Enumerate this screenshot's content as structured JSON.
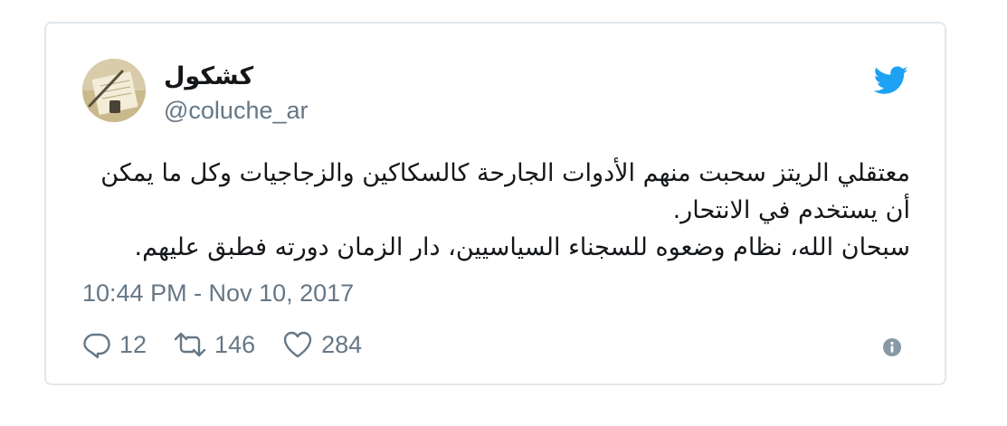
{
  "user": {
    "display_name": "كشكول",
    "handle": "@coluche_ar"
  },
  "tweet": {
    "lines": [
      "معتقلي الريتز سحبت منهم الأدوات الجارحة كالسكاكين والزجاجيات وكل ما يمكن",
      "أن يستخدم في الانتحار.",
      "سبحان الله، نظام وضعوه للسجناء السياسيين، دار الزمان دورته فطبق عليهم."
    ],
    "timestamp": "10:44 PM - Nov 10, 2017"
  },
  "actions": {
    "replies": "12",
    "retweets": "146",
    "likes": "284"
  },
  "icons": {
    "brand": "twitter-bird-icon",
    "reply": "reply-icon",
    "retweet": "retweet-icon",
    "like": "heart-icon",
    "info": "info-icon"
  },
  "colors": {
    "twitter_blue": "#1da1f2",
    "secondary_text": "#657786",
    "primary_text": "#14171a",
    "border": "#e1e8ed"
  }
}
